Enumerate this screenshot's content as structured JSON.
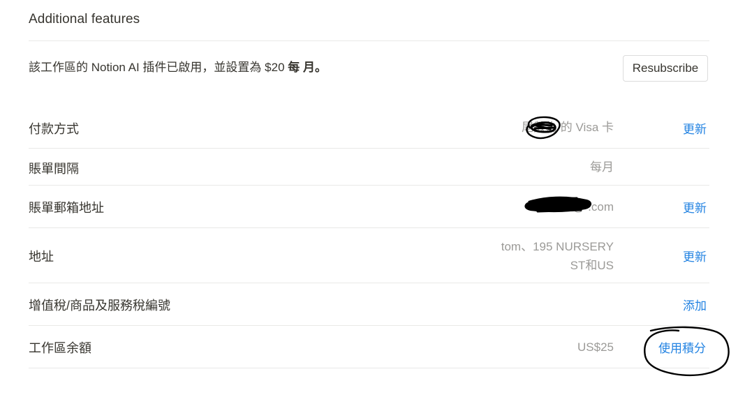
{
  "section": {
    "title": "Additional features"
  },
  "addon": {
    "description_prefix": "該工作區的 Notion AI 插件已啟用，並設置為 $20 ",
    "description_bold": "每 月。",
    "resubscribe_label": "Resubscribe"
  },
  "billing": {
    "payment_method": {
      "label": "付款方式",
      "value": "尾數為 的 Visa 卡",
      "action": "更新"
    },
    "billing_interval": {
      "label": "賬單間隔",
      "value": "每月"
    },
    "billing_email": {
      "label": "賬單郵箱地址",
      "value": "bbb@ .com",
      "action": "更新"
    },
    "address": {
      "label": "地址",
      "value_line1": "tom、195 NURSERY",
      "value_line2": "ST和US",
      "action": "更新"
    },
    "tax_id": {
      "label": "增值稅/商品及服務稅編號",
      "action": "添加"
    },
    "workspace_balance": {
      "label": "工作區余額",
      "value": "US$25",
      "action": "使用積分"
    }
  },
  "colors": {
    "text": "#37352f",
    "muted": "#9b9a97",
    "link": "#2383e2",
    "divider": "#e9e9e7",
    "annotation_ink": "#000000"
  },
  "annotations": {
    "redaction_marks": [
      "payment-card-last-digits",
      "billing-email-domain"
    ],
    "circle_marks": [
      "card-digits-circle",
      "use-credits-circle"
    ]
  }
}
